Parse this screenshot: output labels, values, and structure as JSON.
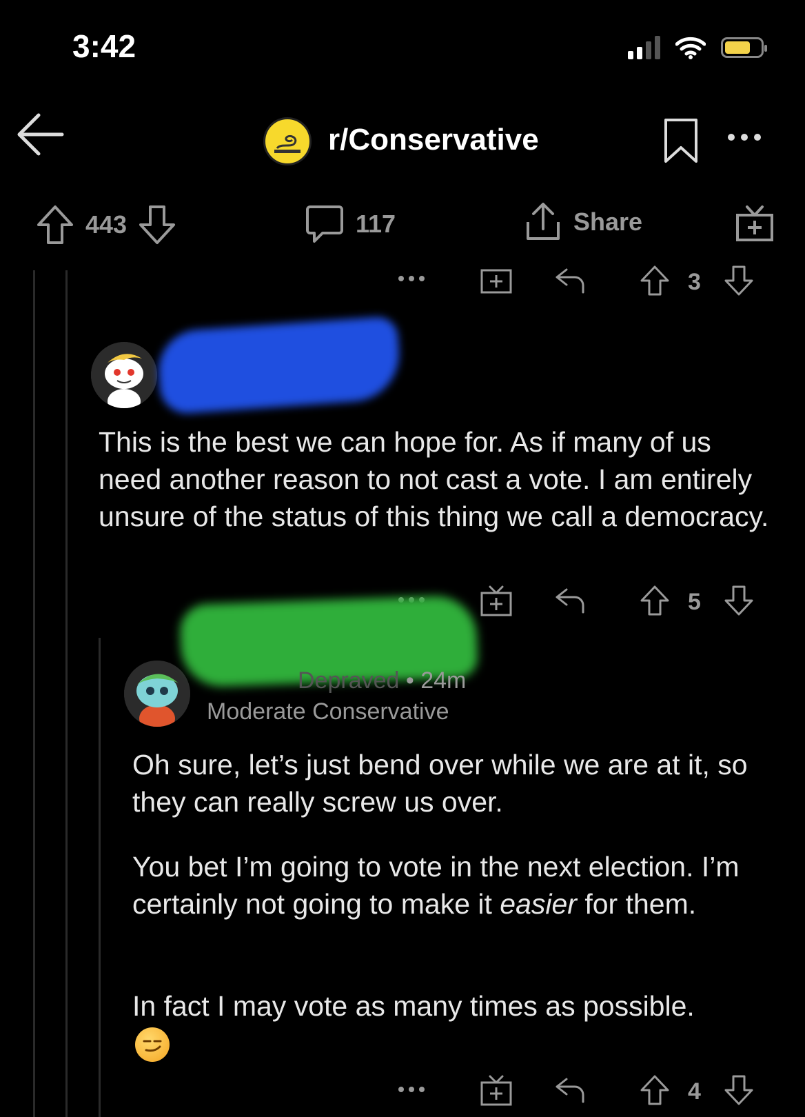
{
  "status_bar": {
    "time": "3:42"
  },
  "header": {
    "subreddit": "r/Conservative"
  },
  "post_actions": {
    "upvotes": "443",
    "comments": "117",
    "share_label": "Share"
  },
  "parent_comment_actions": {
    "score": "3"
  },
  "comment1": {
    "text": "This is the best we can hope for.  As if many of us need another reason to not cast a vote.  I am entirely unsure of the status of this thing we call a democracy.",
    "score": "5"
  },
  "comment2": {
    "username_visible": "Depraved",
    "age": "24m",
    "flair": "Moderate Conservative",
    "paragraph1": "Oh sure, let’s just bend over while we are at it, so they can really screw us over.",
    "paragraph2_before": "You bet I’m going to vote in the next election. I’m certainly not going to make it ",
    "paragraph2_em": "easier",
    "paragraph2_after": " for them.",
    "paragraph3": "In fact I may vote as many times as possible.",
    "emoji": "smirking-face",
    "score": "4"
  },
  "colors": {
    "background": "#000000",
    "text": "#e8e8e8",
    "muted": "#9a9a9a",
    "accent_battery": "#f3d24a"
  }
}
